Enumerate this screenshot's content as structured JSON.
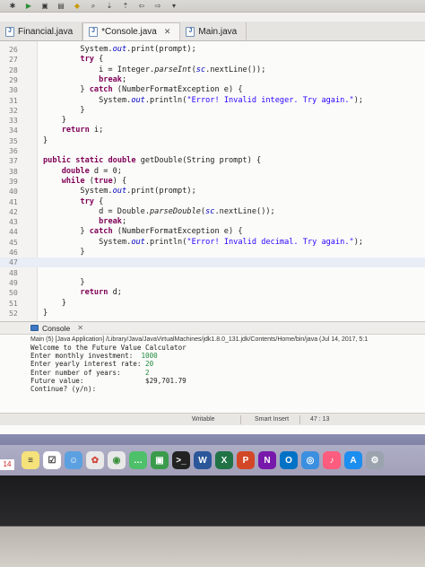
{
  "editor_tabs": [
    {
      "label": "Financial.java",
      "active": false
    },
    {
      "label": "*Console.java",
      "active": true
    },
    {
      "label": "Main.java",
      "active": false
    }
  ],
  "code_lines": [
    {
      "num": "26",
      "text": "        System.out.print(prompt);"
    },
    {
      "num": "27",
      "text": "        try {"
    },
    {
      "num": "28",
      "text": "            i = Integer.parseInt(sc.nextLine());"
    },
    {
      "num": "29",
      "text": "            break;"
    },
    {
      "num": "30",
      "text": "        } catch (NumberFormatException e) {"
    },
    {
      "num": "31",
      "text": "            System.out.println(\"Error! Invalid integer. Try again.\");"
    },
    {
      "num": "32",
      "text": "        }"
    },
    {
      "num": "33",
      "text": "    }"
    },
    {
      "num": "34",
      "text": "    return i;"
    },
    {
      "num": "35",
      "text": "}"
    },
    {
      "num": "36",
      "text": ""
    },
    {
      "num": "37",
      "text": "public static double getDouble(String prompt) {"
    },
    {
      "num": "38",
      "text": "    double d = 0;"
    },
    {
      "num": "39",
      "text": "    while (true) {"
    },
    {
      "num": "40",
      "text": "        System.out.print(prompt);"
    },
    {
      "num": "41",
      "text": "        try {"
    },
    {
      "num": "42",
      "text": "            d = Double.parseDouble(sc.nextLine());"
    },
    {
      "num": "43",
      "text": "            break;"
    },
    {
      "num": "44",
      "text": "        } catch (NumberFormatException e) {"
    },
    {
      "num": "45",
      "text": "            System.out.println(\"Error! Invalid decimal. Try again.\");"
    },
    {
      "num": "46",
      "text": "        }"
    },
    {
      "num": "47",
      "text": ""
    },
    {
      "num": "48",
      "text": ""
    },
    {
      "num": "49",
      "text": "        }"
    },
    {
      "num": "50",
      "text": "        return d;"
    },
    {
      "num": "51",
      "text": "    }"
    },
    {
      "num": "52",
      "text": "}"
    }
  ],
  "console": {
    "title": "Console",
    "path": "Main (5) [Java Application] /Library/Java/JavaVirtualMachines/jdk1.8.0_131.jdk/Contents/Home/bin/java (Jul 14, 2017, 5:1",
    "lines": [
      {
        "text": "Welcome to the Future Value Calculator",
        "input": ""
      },
      {
        "text": "",
        "input": ""
      },
      {
        "text": "Enter monthly investment:  ",
        "input": "1000"
      },
      {
        "text": "Enter yearly interest rate: ",
        "input": "20"
      },
      {
        "text": "Enter number of years:      ",
        "input": "2"
      },
      {
        "text": "Future value:               $29,701.79",
        "input": ""
      },
      {
        "text": "",
        "input": ""
      },
      {
        "text": "Continue? (y/n):",
        "input": ""
      }
    ]
  },
  "status_bar": {
    "mode": "Writable",
    "insert": "Smart Insert",
    "position": "47 : 13"
  },
  "dock": {
    "date": "14",
    "apps": [
      "finder",
      "notes",
      "reminders",
      "photos",
      "chrome",
      "messages",
      "facetime",
      "terminal",
      "word",
      "excel",
      "powerpoint",
      "onenote",
      "outlook",
      "safari",
      "music",
      "app-store",
      "launchpad",
      "system-preferences",
      "time-machine"
    ]
  },
  "colors": {
    "keyword": "#7f0055",
    "string": "#2a00ff",
    "field": "#0000c0",
    "console_input": "#1f8a3b",
    "current_line": "#e8edf6"
  }
}
